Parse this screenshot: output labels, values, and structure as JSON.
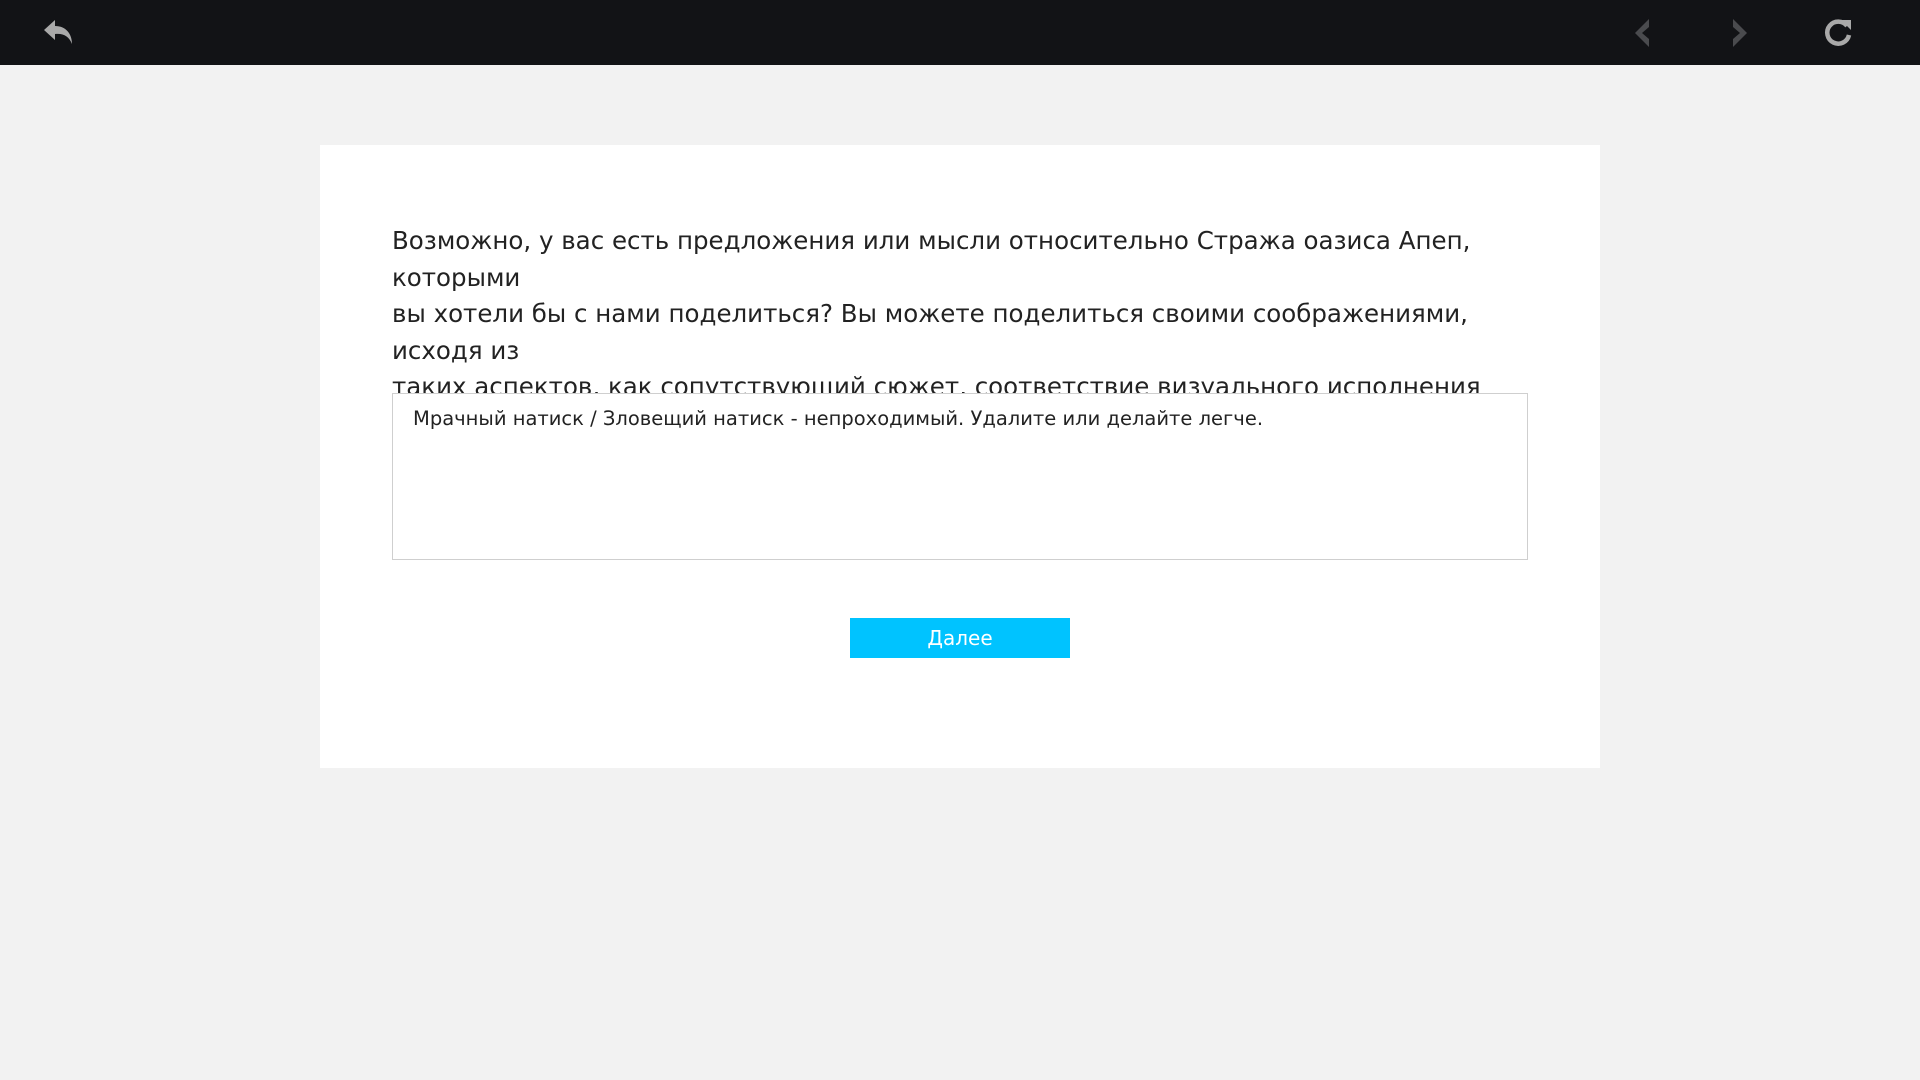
{
  "toolbar": {
    "icons": [
      "back-arrow-icon",
      "previous-icon",
      "next-icon",
      "refresh-icon"
    ],
    "colors": {
      "background": "#121316",
      "active_icon": "#a9a9a9",
      "disabled_icon": "#4a4b4e"
    }
  },
  "survey": {
    "question": " Возможно, у вас есть предложения или мысли относительно Стража оазиса Апеп, которыми\nвы хотели бы с нами поделиться? Вы можете поделиться своими соображениями, исходя из\nтаких аспектов, как сопутствующий сюжет, соответствие визуального исполнения\nустоявшейся среде повествования и др.  (Введите ответ)",
    "answer_value": "Мрачный натиск / Зловещий натиск - непроходимый. Удалите или делайте легче.",
    "next_label": "Далее"
  },
  "colors": {
    "page_background": "#f2f2f2",
    "card_background": "#ffffff",
    "accent": "#00c3ff"
  }
}
